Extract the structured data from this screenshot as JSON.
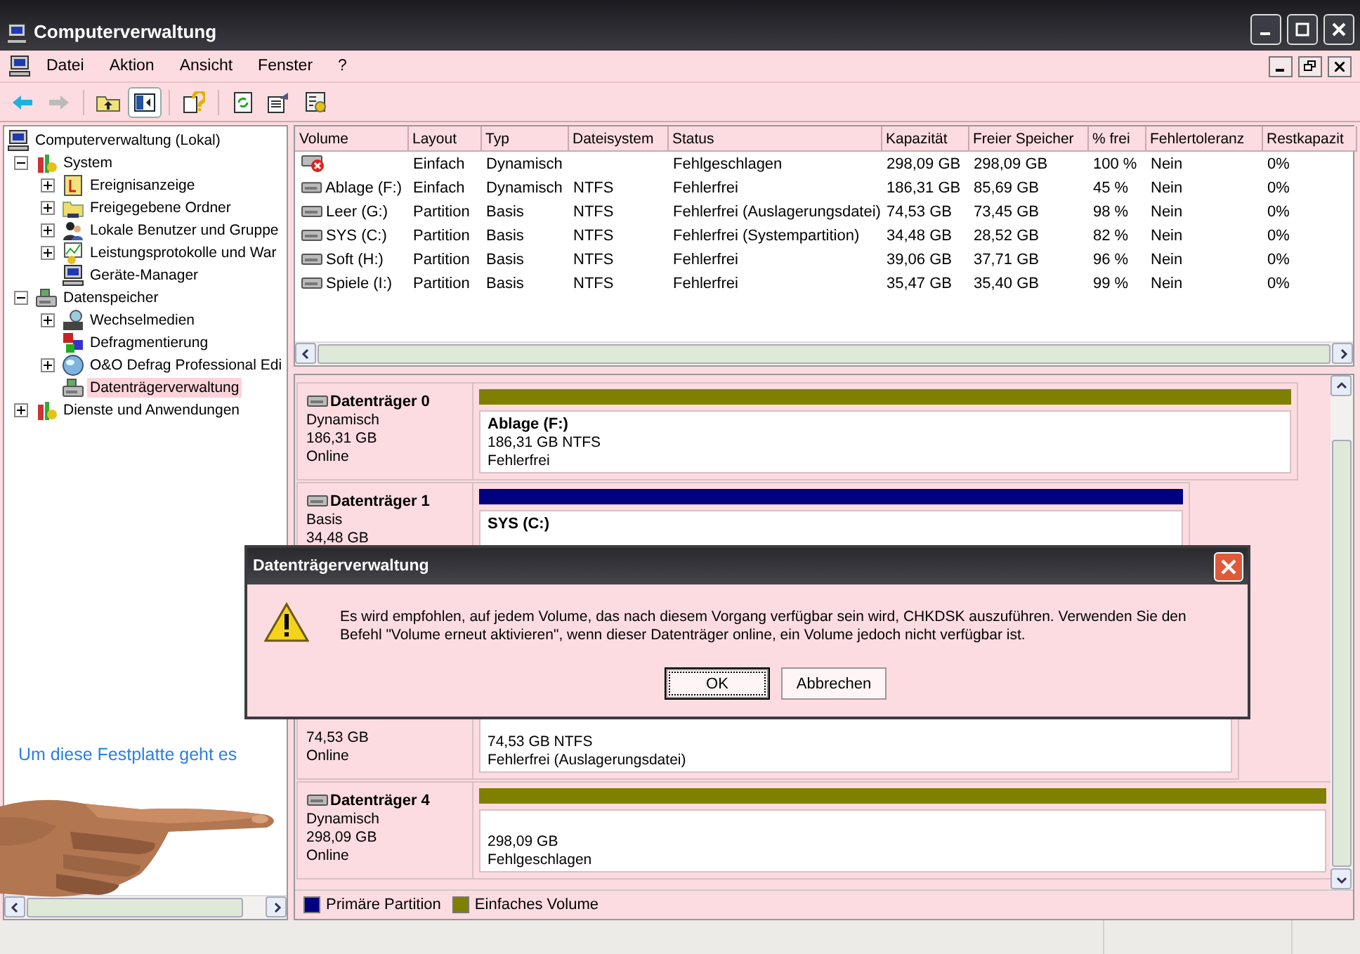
{
  "window": {
    "title": "Computerverwaltung"
  },
  "menu": [
    "Datei",
    "Aktion",
    "Ansicht",
    "Fenster",
    "?"
  ],
  "toolbar": [
    {
      "kind": "back",
      "disabled": false
    },
    {
      "kind": "forward",
      "disabled": true
    },
    {
      "kind": "up",
      "disabled": false
    },
    {
      "kind": "tree",
      "disabled": false
    },
    {
      "kind": "help",
      "disabled": false
    },
    {
      "kind": "refresh",
      "disabled": false
    },
    {
      "kind": "export",
      "disabled": false
    },
    {
      "kind": "properties",
      "disabled": false
    }
  ],
  "tree": [
    {
      "label": "Computerverwaltung (Lokal)",
      "selected": false,
      "children": [
        {
          "label": "System",
          "selected": false,
          "expanded": true,
          "children": [
            {
              "label": "Ereignisanzeige",
              "selected": false,
              "expanded": false
            },
            {
              "label": "Freigegebene Ordner",
              "selected": false,
              "expanded": false
            },
            {
              "label": "Lokale Benutzer und Gruppe",
              "selected": false,
              "expanded": false
            },
            {
              "label": "Leistungsprotokolle und War",
              "selected": false,
              "expanded": false
            },
            {
              "label": "Geräte-Manager",
              "selected": false
            }
          ]
        },
        {
          "label": "Datenspeicher",
          "selected": false,
          "expanded": true,
          "children": [
            {
              "label": "Wechselmedien",
              "selected": false,
              "expanded": false
            },
            {
              "label": "Defragmentierung",
              "selected": false
            },
            {
              "label": "O&O Defrag Professional Edi",
              "selected": false,
              "expanded": false
            },
            {
              "label": "Datenträgerverwaltung",
              "selected": true
            }
          ]
        },
        {
          "label": "Dienste und Anwendungen",
          "selected": false,
          "expanded": false
        }
      ]
    }
  ],
  "table": {
    "columns": [
      "Volume",
      "Layout",
      "Typ",
      "Dateisystem",
      "Status",
      "Kapazität",
      "Freier Speicher",
      "% frei",
      "Fehlertoleranz",
      "Restkapazit"
    ],
    "rows": [
      {
        "failed": true,
        "cells": [
          "",
          "Einfach",
          "Dynamisch",
          "",
          "Fehlgeschlagen",
          "298,09 GB",
          "298,09 GB",
          "100 %",
          "Nein",
          "0%"
        ]
      },
      {
        "failed": false,
        "cells": [
          "Ablage (F:)",
          "Einfach",
          "Dynamisch",
          "NTFS",
          "Fehlerfrei",
          "186,31 GB",
          "85,69 GB",
          "45 %",
          "Nein",
          "0%"
        ]
      },
      {
        "failed": false,
        "cells": [
          "Leer (G:)",
          "Partition",
          "Basis",
          "NTFS",
          "Fehlerfrei (Auslagerungsdatei)",
          "74,53 GB",
          "73,45 GB",
          "98 %",
          "Nein",
          "0%"
        ]
      },
      {
        "failed": false,
        "cells": [
          "SYS (C:)",
          "Partition",
          "Basis",
          "NTFS",
          "Fehlerfrei (Systempartition)",
          "34,48 GB",
          "28,52 GB",
          "82 %",
          "Nein",
          "0%"
        ]
      },
      {
        "failed": false,
        "cells": [
          "Soft (H:)",
          "Partition",
          "Basis",
          "NTFS",
          "Fehlerfrei",
          "39,06 GB",
          "37,71 GB",
          "96 %",
          "Nein",
          "0%"
        ]
      },
      {
        "failed": false,
        "cells": [
          "Spiele (I:)",
          "Partition",
          "Basis",
          "NTFS",
          "Fehlerfrei",
          "35,47 GB",
          "35,40 GB",
          "99 %",
          "Nein",
          "0%"
        ]
      }
    ]
  },
  "disks": [
    {
      "name": "Datenträger 0",
      "type": "Dynamisch",
      "size": "186,31 GB",
      "status": "Online",
      "partition": {
        "kind": "simple",
        "label": "Ablage  (F:)",
        "info": "186,31 GB NTFS",
        "status": "Fehlerfrei"
      }
    },
    {
      "name": "Datenträger 1",
      "type": "Basis",
      "size": "34,48 GB",
      "partition": {
        "kind": "primary",
        "label": "SYS  (C:)"
      }
    },
    {
      "size": "74,53 GB",
      "status": "Online",
      "partition": {
        "info": "74,53 GB NTFS",
        "status": "Fehlerfrei (Auslagerungsdatei)"
      }
    },
    {
      "name": "Datenträger 4",
      "type": "Dynamisch",
      "size": "298,09 GB",
      "status": "Online",
      "partition": {
        "kind": "simple",
        "info": "298,09 GB",
        "status": "Fehlgeschlagen"
      }
    }
  ],
  "legend": [
    {
      "label": "Primäre Partition",
      "color": "#000080"
    },
    {
      "label": "Einfaches Volume",
      "color": "#808000"
    }
  ],
  "annotation": "Um diese Festplatte geht es",
  "dialog": {
    "title": "Datenträgerverwaltung",
    "message": "Es wird empfohlen, auf jedem Volume, das nach diesem Vorgang verfügbar sein wird, CHKDSK auszuführen. Verwenden Sie den Befehl \"Volume erneut aktivieren\", wenn dieser Datenträger online, ein Volume jedoch nicht verfügbar ist.",
    "buttons": [
      {
        "label": "OK",
        "focused": true
      },
      {
        "label": "Abbrechen",
        "focused": false
      }
    ]
  }
}
